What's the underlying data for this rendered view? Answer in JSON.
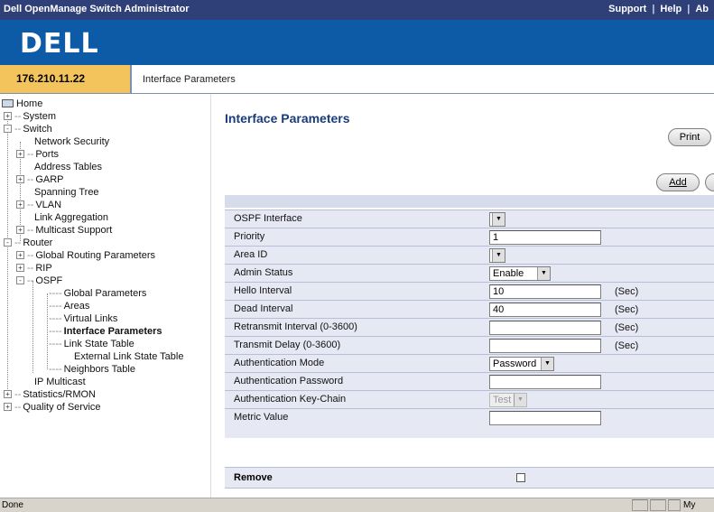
{
  "window": {
    "app_title": "Dell OpenManage Switch Administrator",
    "links": [
      "Support",
      "Help",
      "Ab"
    ]
  },
  "brand": {
    "logo": "DELL"
  },
  "ip_bar": {
    "ip": "176.210.11.22",
    "breadcrumb": "Interface Parameters"
  },
  "tree": {
    "home": "Home",
    "system": "System",
    "switch": "Switch",
    "network_security": "Network Security",
    "ports": "Ports",
    "address_tables": "Address Tables",
    "garp": "GARP",
    "spanning_tree": "Spanning Tree",
    "vlan": "VLAN",
    "link_aggregation": "Link Aggregation",
    "multicast_support": "Multicast Support",
    "router": "Router",
    "global_routing_parameters": "Global Routing Parameters",
    "rip": "RIP",
    "ospf": "OSPF",
    "global_parameters": "Global Parameters",
    "areas": "Areas",
    "virtual_links": "Virtual Links",
    "interface_parameters": "Interface Parameters",
    "link_state_table": "Link State Table",
    "external_link_state_table": "External Link State Table",
    "neighbors_table": "Neighbors Table",
    "ip_multicast": "IP Multicast",
    "statistics_rmon": "Statistics/RMON",
    "quality_of_service": "Quality of Service"
  },
  "main": {
    "title": "Interface Parameters",
    "print_label": "Print",
    "add_label": "Add",
    "form": {
      "ospf_interface": {
        "label": "OSPF Interface",
        "value": ""
      },
      "priority": {
        "label": "Priority",
        "value": "1"
      },
      "area_id": {
        "label": "Area ID",
        "value": ""
      },
      "admin_status": {
        "label": "Admin Status",
        "value": "Enable"
      },
      "hello_interval": {
        "label": "Hello Interval",
        "value": "10",
        "unit": "(Sec)"
      },
      "dead_interval": {
        "label": "Dead Interval",
        "value": "40",
        "unit": "(Sec)"
      },
      "retransmit_interval": {
        "label": "Retransmit Interval (0-3600)",
        "value": "",
        "unit": "(Sec)"
      },
      "transmit_delay": {
        "label": "Transmit Delay (0-3600)",
        "value": "",
        "unit": "(Sec)"
      },
      "auth_mode": {
        "label": "Authentication Mode",
        "value": "Password"
      },
      "auth_password": {
        "label": "Authentication Password",
        "value": ""
      },
      "auth_key_chain": {
        "label": "Authentication Key-Chain",
        "value": "Test"
      },
      "metric_value": {
        "label": "Metric Value",
        "value": ""
      }
    },
    "remove_label": "Remove"
  },
  "status_bar": {
    "status": "Done",
    "zone": "My"
  }
}
